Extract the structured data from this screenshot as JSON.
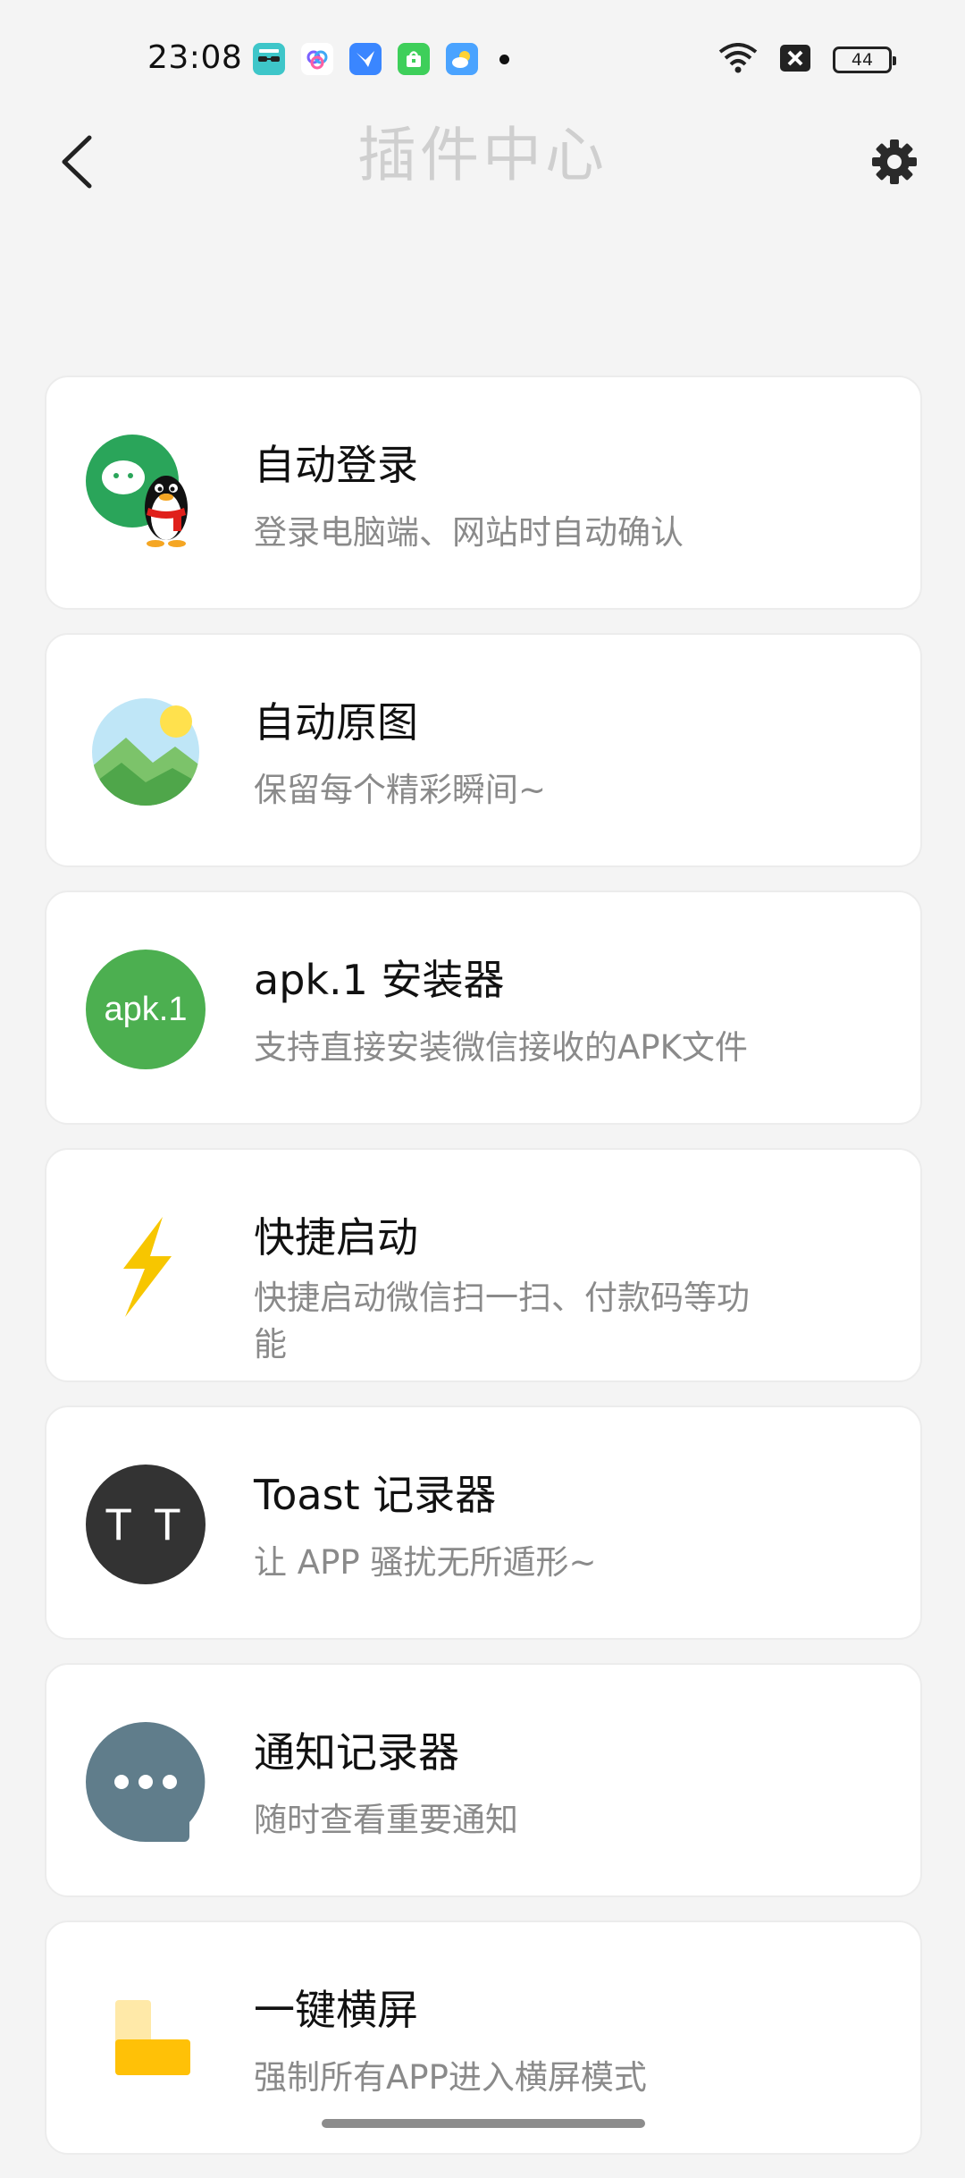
{
  "status_bar": {
    "time": "23:08",
    "battery": "44"
  },
  "header": {
    "title": "插件中心"
  },
  "plugins": [
    {
      "title": "自动登录",
      "description": "登录电脑端、网站时自动确认",
      "icon": "wechat-qq-icon"
    },
    {
      "title": "自动原图",
      "description": "保留每个精彩瞬间~",
      "icon": "landscape-photo-icon"
    },
    {
      "title": "apk.1 安装器",
      "description": "支持直接安装微信接收的APK文件",
      "icon": "apk-icon",
      "icon_text": "apk.1"
    },
    {
      "title": "快捷启动",
      "description": "快捷启动微信扫一扫、付款码等功能",
      "icon": "lightning-icon"
    },
    {
      "title": "Toast 记录器",
      "description": "让 APP 骚扰无所遁形~",
      "icon": "toast-icon",
      "icon_text": "T T"
    },
    {
      "title": "通知记录器",
      "description": "随时查看重要通知",
      "icon": "chat-bubble-icon"
    },
    {
      "title": "一键横屏",
      "description": "强制所有APP进入横屏模式",
      "icon": "rotate-screen-icon"
    }
  ],
  "colors": {
    "background": "#f4f4f4",
    "card": "#ffffff",
    "wechat_green": "#07c160",
    "apk_green": "#4caf50",
    "lightning_yellow": "#f7c600",
    "toast_dark": "#333333",
    "chat_slate": "#607d8b",
    "rotate_yellow": "#ffc107"
  }
}
